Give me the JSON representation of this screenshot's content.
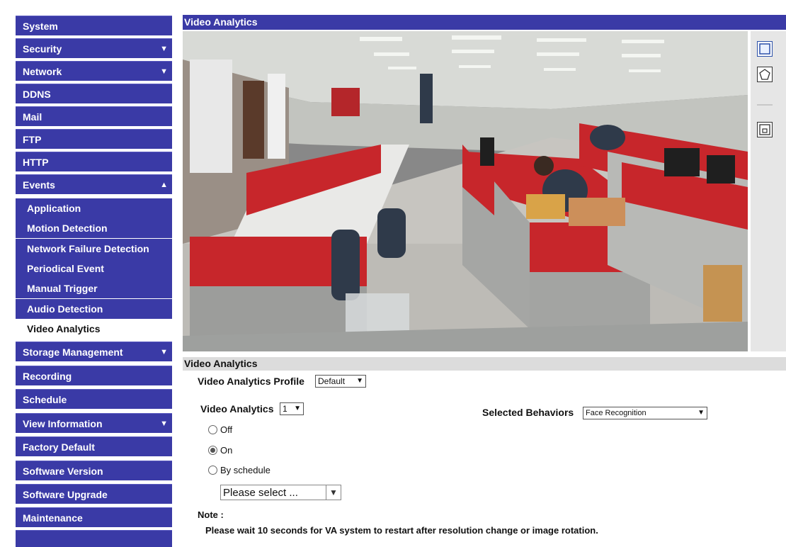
{
  "header": {
    "title": "Video Analytics"
  },
  "sidebar": {
    "items": [
      {
        "label": "System",
        "arrow": ""
      },
      {
        "label": "Security",
        "arrow": "▼"
      },
      {
        "label": "Network",
        "arrow": "▼"
      },
      {
        "label": "DDNS",
        "arrow": ""
      },
      {
        "label": "Mail",
        "arrow": ""
      },
      {
        "label": "FTP",
        "arrow": ""
      },
      {
        "label": "HTTP",
        "arrow": ""
      },
      {
        "label": "Events",
        "arrow": "▲"
      }
    ],
    "event_sub_items": [
      "Application",
      "Motion Detection",
      "Network Failure Detection",
      "Periodical Event",
      "Manual Trigger",
      "Audio Detection",
      "Video Analytics"
    ],
    "items_after": [
      {
        "label": "Storage Management",
        "arrow": "▼"
      },
      {
        "label": "Recording",
        "arrow": ""
      },
      {
        "label": "Schedule",
        "arrow": ""
      },
      {
        "label": "View Information",
        "arrow": "▼"
      },
      {
        "label": "Factory Default",
        "arrow": ""
      },
      {
        "label": "Software Version",
        "arrow": ""
      },
      {
        "label": "Software Upgrade",
        "arrow": ""
      },
      {
        "label": "Maintenance",
        "arrow": ""
      }
    ]
  },
  "section": {
    "title": "Video Analytics"
  },
  "form": {
    "profile_label": "Video Analytics Profile",
    "profile_value": "Default",
    "va_label": "Video Analytics",
    "va_value": "1",
    "behaviors_label": "Selected Behaviors",
    "behaviors_value": "Face Recognition",
    "radio_off": "Off",
    "radio_on": "On",
    "radio_schedule": "By schedule",
    "schedule_placeholder": "Please select ...",
    "note_label": "Note :",
    "note_text": "Please wait 10 seconds for VA system to restart after resolution change or image rotation."
  },
  "icons": {
    "rect_tool": "rectangle-icon",
    "polygon_tool": "pentagon-icon",
    "fullscreen_tool": "window-icon"
  }
}
